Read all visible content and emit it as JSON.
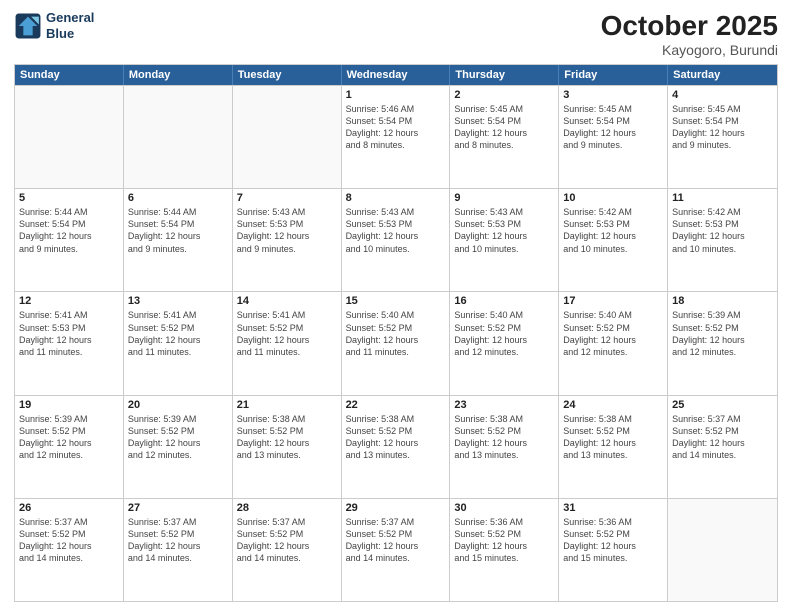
{
  "logo": {
    "line1": "General",
    "line2": "Blue"
  },
  "title": "October 2025",
  "location": "Kayogoro, Burundi",
  "days": [
    "Sunday",
    "Monday",
    "Tuesday",
    "Wednesday",
    "Thursday",
    "Friday",
    "Saturday"
  ],
  "rows": [
    [
      {
        "day": "",
        "info": ""
      },
      {
        "day": "",
        "info": ""
      },
      {
        "day": "",
        "info": ""
      },
      {
        "day": "1",
        "info": "Sunrise: 5:46 AM\nSunset: 5:54 PM\nDaylight: 12 hours\nand 8 minutes."
      },
      {
        "day": "2",
        "info": "Sunrise: 5:45 AM\nSunset: 5:54 PM\nDaylight: 12 hours\nand 8 minutes."
      },
      {
        "day": "3",
        "info": "Sunrise: 5:45 AM\nSunset: 5:54 PM\nDaylight: 12 hours\nand 9 minutes."
      },
      {
        "day": "4",
        "info": "Sunrise: 5:45 AM\nSunset: 5:54 PM\nDaylight: 12 hours\nand 9 minutes."
      }
    ],
    [
      {
        "day": "5",
        "info": "Sunrise: 5:44 AM\nSunset: 5:54 PM\nDaylight: 12 hours\nand 9 minutes."
      },
      {
        "day": "6",
        "info": "Sunrise: 5:44 AM\nSunset: 5:54 PM\nDaylight: 12 hours\nand 9 minutes."
      },
      {
        "day": "7",
        "info": "Sunrise: 5:43 AM\nSunset: 5:53 PM\nDaylight: 12 hours\nand 9 minutes."
      },
      {
        "day": "8",
        "info": "Sunrise: 5:43 AM\nSunset: 5:53 PM\nDaylight: 12 hours\nand 10 minutes."
      },
      {
        "day": "9",
        "info": "Sunrise: 5:43 AM\nSunset: 5:53 PM\nDaylight: 12 hours\nand 10 minutes."
      },
      {
        "day": "10",
        "info": "Sunrise: 5:42 AM\nSunset: 5:53 PM\nDaylight: 12 hours\nand 10 minutes."
      },
      {
        "day": "11",
        "info": "Sunrise: 5:42 AM\nSunset: 5:53 PM\nDaylight: 12 hours\nand 10 minutes."
      }
    ],
    [
      {
        "day": "12",
        "info": "Sunrise: 5:41 AM\nSunset: 5:53 PM\nDaylight: 12 hours\nand 11 minutes."
      },
      {
        "day": "13",
        "info": "Sunrise: 5:41 AM\nSunset: 5:52 PM\nDaylight: 12 hours\nand 11 minutes."
      },
      {
        "day": "14",
        "info": "Sunrise: 5:41 AM\nSunset: 5:52 PM\nDaylight: 12 hours\nand 11 minutes."
      },
      {
        "day": "15",
        "info": "Sunrise: 5:40 AM\nSunset: 5:52 PM\nDaylight: 12 hours\nand 11 minutes."
      },
      {
        "day": "16",
        "info": "Sunrise: 5:40 AM\nSunset: 5:52 PM\nDaylight: 12 hours\nand 12 minutes."
      },
      {
        "day": "17",
        "info": "Sunrise: 5:40 AM\nSunset: 5:52 PM\nDaylight: 12 hours\nand 12 minutes."
      },
      {
        "day": "18",
        "info": "Sunrise: 5:39 AM\nSunset: 5:52 PM\nDaylight: 12 hours\nand 12 minutes."
      }
    ],
    [
      {
        "day": "19",
        "info": "Sunrise: 5:39 AM\nSunset: 5:52 PM\nDaylight: 12 hours\nand 12 minutes."
      },
      {
        "day": "20",
        "info": "Sunrise: 5:39 AM\nSunset: 5:52 PM\nDaylight: 12 hours\nand 12 minutes."
      },
      {
        "day": "21",
        "info": "Sunrise: 5:38 AM\nSunset: 5:52 PM\nDaylight: 12 hours\nand 13 minutes."
      },
      {
        "day": "22",
        "info": "Sunrise: 5:38 AM\nSunset: 5:52 PM\nDaylight: 12 hours\nand 13 minutes."
      },
      {
        "day": "23",
        "info": "Sunrise: 5:38 AM\nSunset: 5:52 PM\nDaylight: 12 hours\nand 13 minutes."
      },
      {
        "day": "24",
        "info": "Sunrise: 5:38 AM\nSunset: 5:52 PM\nDaylight: 12 hours\nand 13 minutes."
      },
      {
        "day": "25",
        "info": "Sunrise: 5:37 AM\nSunset: 5:52 PM\nDaylight: 12 hours\nand 14 minutes."
      }
    ],
    [
      {
        "day": "26",
        "info": "Sunrise: 5:37 AM\nSunset: 5:52 PM\nDaylight: 12 hours\nand 14 minutes."
      },
      {
        "day": "27",
        "info": "Sunrise: 5:37 AM\nSunset: 5:52 PM\nDaylight: 12 hours\nand 14 minutes."
      },
      {
        "day": "28",
        "info": "Sunrise: 5:37 AM\nSunset: 5:52 PM\nDaylight: 12 hours\nand 14 minutes."
      },
      {
        "day": "29",
        "info": "Sunrise: 5:37 AM\nSunset: 5:52 PM\nDaylight: 12 hours\nand 14 minutes."
      },
      {
        "day": "30",
        "info": "Sunrise: 5:36 AM\nSunset: 5:52 PM\nDaylight: 12 hours\nand 15 minutes."
      },
      {
        "day": "31",
        "info": "Sunrise: 5:36 AM\nSunset: 5:52 PM\nDaylight: 12 hours\nand 15 minutes."
      },
      {
        "day": "",
        "info": ""
      }
    ]
  ]
}
